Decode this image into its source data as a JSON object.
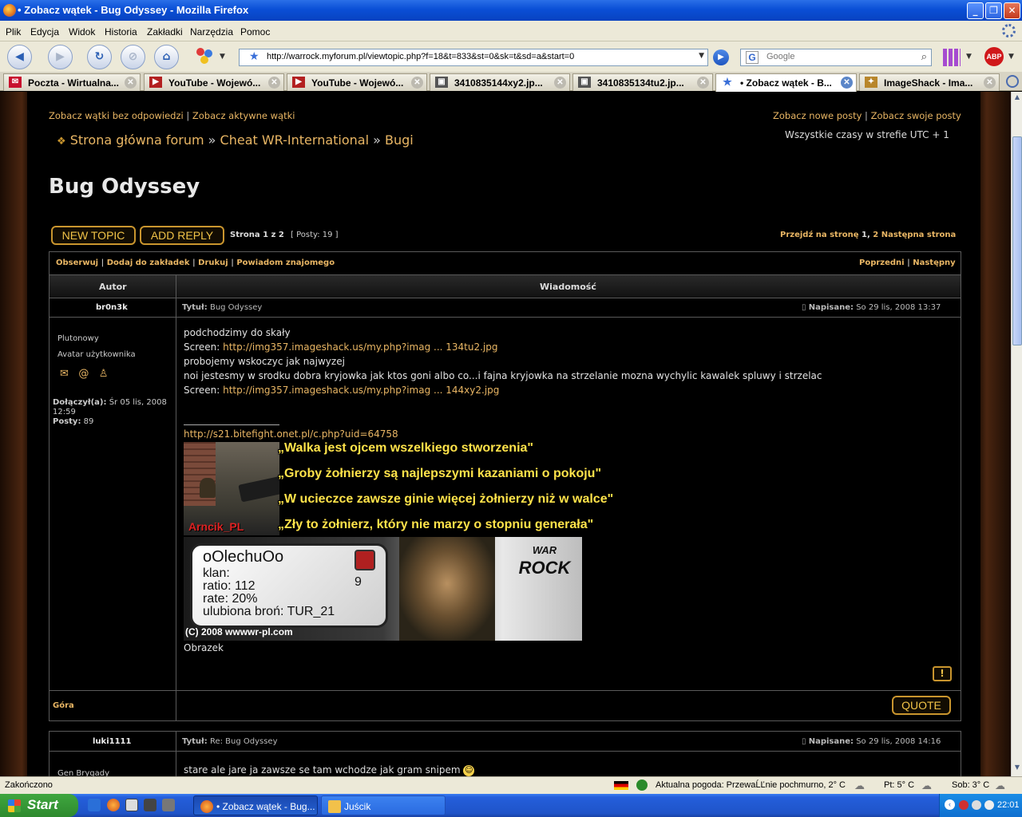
{
  "window": {
    "title": "• Zobacz wątek - Bug Odyssey - Mozilla Firefox"
  },
  "menu": [
    "Plik",
    "Edycja",
    "Widok",
    "Historia",
    "Zakładki",
    "Narzędzia",
    "Pomoc"
  ],
  "nav": {
    "url": "http://warrock.myforum.pl/viewtopic.php?f=18&t=833&st=0&sk=t&sd=a&start=0",
    "search_placeholder": "Google",
    "abp_label": "ABP"
  },
  "tabs": [
    {
      "label": "Poczta - Wirtualna...",
      "icon": "mail-icon",
      "color": "#c8102e"
    },
    {
      "label": "YouTube - Wojewó...",
      "icon": "youtube-icon",
      "color": "#b32020"
    },
    {
      "label": "YouTube - Wojewó...",
      "icon": "youtube-icon",
      "color": "#b32020"
    },
    {
      "label": "3410835144xy2.jp...",
      "icon": "image-icon",
      "color": "#555555"
    },
    {
      "label": "3410835134tu2.jp...",
      "icon": "image-icon",
      "color": "#555555"
    },
    {
      "label": "• Zobacz wątek - B...",
      "icon": "star-icon",
      "color": "#3a6fd8",
      "active": true
    },
    {
      "label": "ImageShack - Ima...",
      "icon": "imageshack-icon",
      "color": "#b8862b"
    }
  ],
  "forum": {
    "top_left_links": [
      "Zobacz wątki bez odpowiedzi",
      "Zobacz aktywne wątki"
    ],
    "top_right_links": [
      "Zobacz nowe posty",
      "Zobacz swoje posty"
    ],
    "breadcrumb": [
      "Strona główna forum",
      "Cheat WR-International",
      "Bugi"
    ],
    "timezone": "Wszystkie czasy w strefie UTC + 1",
    "topic_title": "Bug Odyssey",
    "buttons": {
      "new_topic": "NEW TOPIC",
      "add_reply": "ADD REPLY",
      "quote": "QUOTE",
      "report": "!"
    },
    "pagination": {
      "page_info": "Strona 1 z 2",
      "posts_count": "[ Posty: 19 ]",
      "goto_label": "Przejdź na stronę",
      "page_current": "1",
      "page_next": "2",
      "next_label": "Następna strona"
    },
    "actions": [
      "Obserwuj",
      "Dodaj do zakładek",
      "Drukuj",
      "Powiadom znajomego"
    ],
    "prev_next": [
      "Poprzedni",
      "Następny"
    ],
    "columns": {
      "author": "Autor",
      "message": "Wiadomość"
    },
    "posts": [
      {
        "author": "br0n3k",
        "rank": "Plutonowy",
        "avatar_alt": "Avatar użytkownika",
        "joined_label": "Dołączył(a):",
        "joined_value": "Śr 05 lis, 2008 12:59",
        "posts_label": "Posty:",
        "posts_value": "89",
        "subject_label": "Tytuł:",
        "subject": "Bug Odyssey",
        "posted_label": "Napisane:",
        "posted": "So 29 lis, 2008 13:37",
        "body": [
          {
            "text": "podchodzimy do skały"
          },
          {
            "prefix": "Screen: ",
            "link": "http://img357.imageshack.us/my.php?imag ... 134tu2.jpg"
          },
          {
            "text": "probojemy wskoczyc jak najwyzej"
          },
          {
            "text": "noi jestesmy w srodku dobra kryjowka jak ktos goni albo co...i fajna kryjowka na strzelanie mozna wychylic kawalek spluwy i strzelac"
          },
          {
            "prefix": "Screen: ",
            "link": "http://img357.imageshack.us/my.php?imag ... 144xy2.jpg"
          }
        ],
        "signature": {
          "link": "http://s21.bitefight.onet.pl/c.php?uid=64758",
          "quotes": [
            "„Walka jest ojcem wszelkiego stworzenia\"",
            "„Groby żołnierzy są najlepszymi kazaniami o pokoju\"",
            "„W ucieczce zawsze ginie więcej żołnierzy niż w walce\"",
            "„Zły to żołnierz, który nie marzy o stopniu generała\""
          ],
          "avatar_caption": "Arncik_PL",
          "card": {
            "name": "oOlechuOo",
            "clan": "klan:",
            "ratio": "ratio: 112",
            "rate": "rate: 20%",
            "weapon": "ulubiona broń: TUR_21",
            "level": "9",
            "copyright": "(C) 2008 wwwwr-pl.com",
            "logo_top": "WAR",
            "logo_bottom": "ROCK"
          },
          "caption": "Obrazek"
        },
        "top_link": "Góra"
      },
      {
        "author": "luki1111",
        "rank": "Gen Brygady",
        "subject_label": "Tytuł:",
        "subject": "Re: Bug Odyssey",
        "posted_label": "Napisane:",
        "posted": "So 29 lis, 2008 14:16",
        "body": [
          {
            "text": "stare ale jare ja zawsze se tam wchodze jak gram snipem"
          }
        ]
      }
    ]
  },
  "status": {
    "left": "Zakończono",
    "weather": "Aktualna pogoda: PrzewaĹĽnie pochmurno, 2° C",
    "fri": "Pt: 5° C",
    "sat": "Sob: 3° C"
  },
  "taskbar": {
    "start": "Start",
    "tasks": [
      "• Zobacz wątek - Bug...",
      "Juścik"
    ],
    "time": "22:01"
  }
}
